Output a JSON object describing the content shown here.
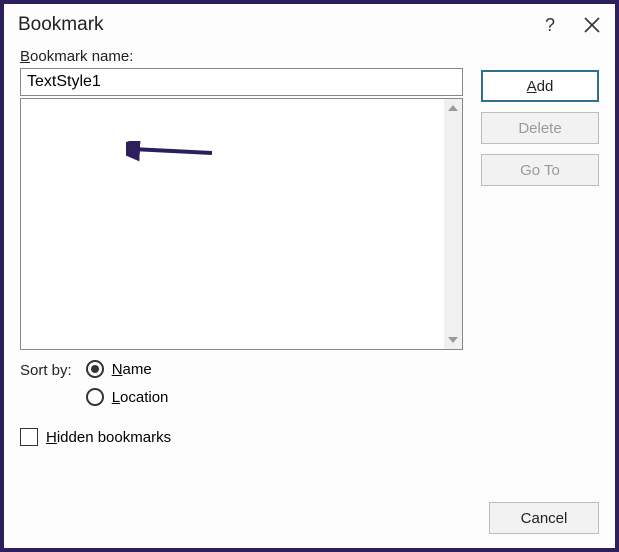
{
  "title": "Bookmark",
  "label_bookmark_name": "Bookmark name:",
  "input_value": "TextStyle1",
  "buttons": {
    "add": "Add",
    "delete": "Delete",
    "goto": "Go To",
    "cancel": "Cancel"
  },
  "sort_by_label": "Sort by:",
  "radios": {
    "name": "Name",
    "location": "Location"
  },
  "checkbox_hidden": "Hidden bookmarks"
}
